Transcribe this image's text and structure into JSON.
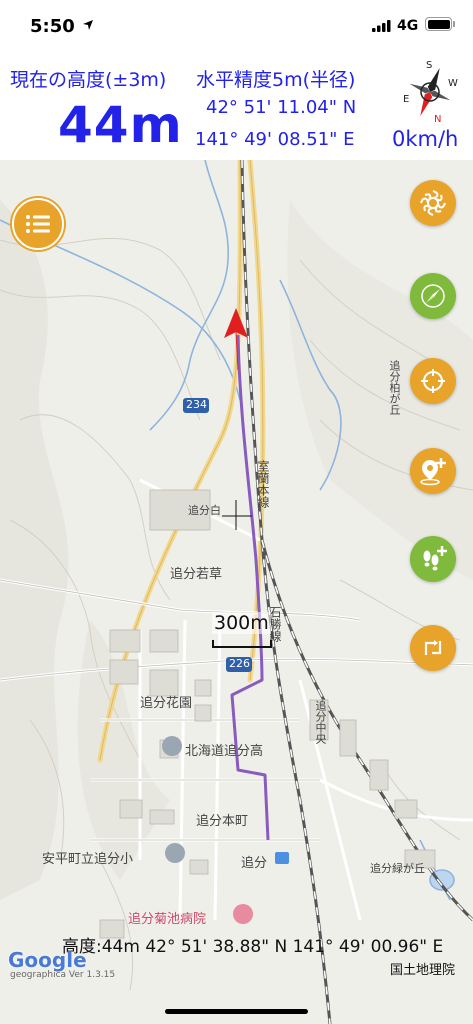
{
  "status_bar": {
    "time": "5:50",
    "network": "4G"
  },
  "info": {
    "altitude_label": "現在の高度(±3m)",
    "altitude_value": "44m",
    "accuracy_label": "水平精度5m(半径)",
    "latitude": "42° 51' 11.04\" N",
    "longitude": "141° 49' 08.51\" E",
    "speed": "0km/h",
    "compass_labels": {
      "north": "N",
      "south": "S",
      "west": "W",
      "east": "E"
    }
  },
  "map": {
    "labels": {
      "route_234": "234",
      "route_226": "226",
      "rail_line": "室蘭本線",
      "rail_line_2": "石勝線",
      "district_wakakusa": "追分若草",
      "district_hanazono": "追分花園",
      "school_high": "北海道追分高",
      "district_honcho": "追分本町",
      "school_elem": "安平町立追分小",
      "station": "追分",
      "hospital": "追分菊池病院",
      "district_shiraito": "追分白",
      "district_chuo": "追分中央",
      "district_kashiwagaoka": "追分柏が丘",
      "district_midorigaoka": "追分緑が丘"
    },
    "scale_label": "300m",
    "bottom_coords": "高度:44m  42° 51' 38.88\" N 141° 49' 00.96\" E",
    "google": "Google",
    "version": "geographica Ver 1.3.15",
    "attribution": "国土地理院"
  },
  "controls": [
    {
      "name": "layers-button",
      "icon": "swirl-icon",
      "color": "#e8a32a"
    },
    {
      "name": "compass-button",
      "icon": "compass-needle-icon",
      "color": "#7fba3c"
    },
    {
      "name": "current-location-button",
      "icon": "crosshair-icon",
      "color": "#e8a32a"
    },
    {
      "name": "add-waypoint-button",
      "icon": "add-pin-icon",
      "color": "#e8a32a"
    },
    {
      "name": "add-track-button",
      "icon": "footprints-add-icon",
      "color": "#7fba3c"
    },
    {
      "name": "track-return-button",
      "icon": "track-return-icon",
      "color": "#e8a32a"
    }
  ],
  "colors": {
    "info_text": "#2222e8",
    "orange": "#e8a32a",
    "green": "#7fba3c",
    "track": "#8a5bbf",
    "heading_arrow": "#e02020"
  }
}
